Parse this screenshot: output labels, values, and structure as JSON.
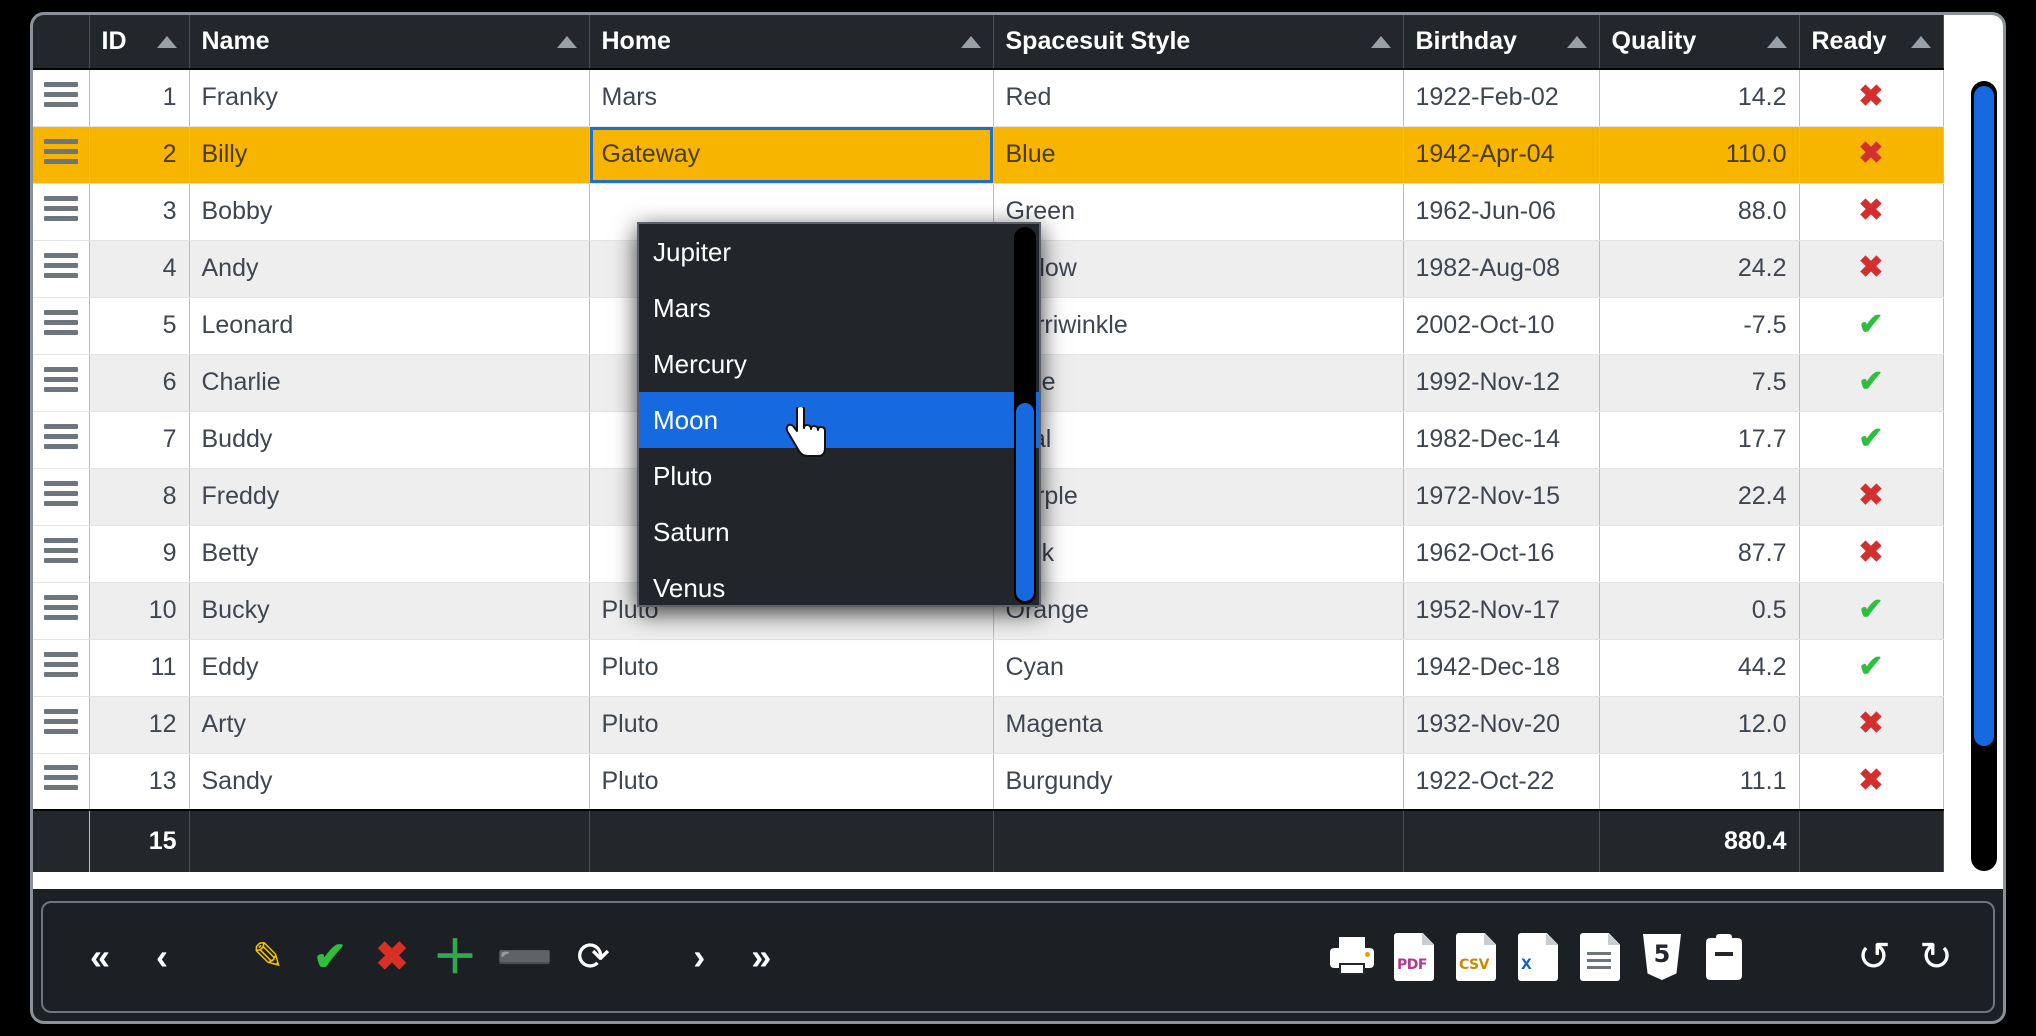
{
  "grid": {
    "columns": [
      {
        "key": "handle",
        "label": "",
        "sortable": false,
        "align": "center"
      },
      {
        "key": "id",
        "label": "ID",
        "sortable": true,
        "align": "right"
      },
      {
        "key": "name",
        "label": "Name",
        "sortable": true,
        "align": "left"
      },
      {
        "key": "home",
        "label": "Home",
        "sortable": true,
        "align": "left"
      },
      {
        "key": "spacesuit",
        "label": "Spacesuit Style",
        "sortable": true,
        "align": "left"
      },
      {
        "key": "birthday",
        "label": "Birthday",
        "sortable": true,
        "align": "left"
      },
      {
        "key": "quality",
        "label": "Quality",
        "sortable": true,
        "align": "right"
      },
      {
        "key": "ready",
        "label": "Ready",
        "sortable": true,
        "align": "center"
      }
    ],
    "rows": [
      {
        "id": "1",
        "name": "Franky",
        "home": "Mars",
        "spacesuit": "Red",
        "birthday": "1922-Feb-02",
        "quality": "14.2",
        "ready": "no"
      },
      {
        "id": "2",
        "name": "Billy",
        "home": "Gateway",
        "spacesuit": "Blue",
        "birthday": "1942-Apr-04",
        "quality": "110.0",
        "ready": "no"
      },
      {
        "id": "3",
        "name": "Bobby",
        "home": "",
        "spacesuit": "Green",
        "birthday": "1962-Jun-06",
        "quality": "88.0",
        "ready": "no"
      },
      {
        "id": "4",
        "name": "Andy",
        "home": "",
        "spacesuit": "Yellow",
        "birthday": "1982-Aug-08",
        "quality": "24.2",
        "ready": "no"
      },
      {
        "id": "5",
        "name": "Leonard",
        "home": "",
        "spacesuit": "Perriwinkle",
        "birthday": "2002-Oct-10",
        "quality": "-7.5",
        "ready": "yes"
      },
      {
        "id": "6",
        "name": "Charlie",
        "home": "",
        "spacesuit": "Blue",
        "birthday": "1992-Nov-12",
        "quality": "7.5",
        "ready": "yes"
      },
      {
        "id": "7",
        "name": "Buddy",
        "home": "",
        "spacesuit": "Teal",
        "birthday": "1982-Dec-14",
        "quality": "17.7",
        "ready": "yes"
      },
      {
        "id": "8",
        "name": "Freddy",
        "home": "",
        "spacesuit": "Purple",
        "birthday": "1972-Nov-15",
        "quality": "22.4",
        "ready": "no"
      },
      {
        "id": "9",
        "name": "Betty",
        "home": "",
        "spacesuit": "Pink",
        "birthday": "1962-Oct-16",
        "quality": "87.7",
        "ready": "no"
      },
      {
        "id": "10",
        "name": "Bucky",
        "home": "Pluto",
        "spacesuit": "Orange",
        "birthday": "1952-Nov-17",
        "quality": "0.5",
        "ready": "yes"
      },
      {
        "id": "11",
        "name": "Eddy",
        "home": "Pluto",
        "spacesuit": "Cyan",
        "birthday": "1942-Dec-18",
        "quality": "44.2",
        "ready": "yes"
      },
      {
        "id": "12",
        "name": "Arty",
        "home": "Pluto",
        "spacesuit": "Magenta",
        "birthday": "1932-Nov-20",
        "quality": "12.0",
        "ready": "no"
      },
      {
        "id": "13",
        "name": "Sandy",
        "home": "Pluto",
        "spacesuit": "Burgundy",
        "birthday": "1922-Oct-22",
        "quality": "11.1",
        "ready": "no"
      }
    ],
    "selected_row_index": 1,
    "editing_cell": {
      "row_index": 1,
      "column": "home",
      "value": "Gateway"
    },
    "footer": {
      "count": "15",
      "quality_total": "880.4"
    },
    "marks": {
      "yes": "✔",
      "no": "✖"
    },
    "colors": {
      "selected_row": "#f7b500",
      "header_bg": "#23272c",
      "highlight": "#1769e0",
      "check": "#2fbf3f",
      "cross": "#d32f2f"
    }
  },
  "dropdown": {
    "open": true,
    "for_column": "Home",
    "highlighted": "Moon",
    "options": [
      {
        "label": "Jupiter"
      },
      {
        "label": "Mars"
      },
      {
        "label": "Mercury"
      },
      {
        "label": "Moon"
      },
      {
        "label": "Pluto"
      },
      {
        "label": "Saturn"
      },
      {
        "label": "Venus"
      }
    ]
  },
  "toolbar": {
    "nav": [
      {
        "name": "first-page",
        "glyph": "«"
      },
      {
        "name": "previous-page",
        "glyph": "‹"
      }
    ],
    "edit": [
      {
        "name": "edit-row",
        "glyph": "✎",
        "title": "Edit"
      },
      {
        "name": "accept-edit",
        "glyph": "✔",
        "title": "Accept"
      },
      {
        "name": "cancel-edit",
        "glyph": "✖",
        "title": "Cancel"
      },
      {
        "name": "add-row",
        "glyph": "＋",
        "title": "Add"
      },
      {
        "name": "delete-row",
        "glyph": "➖",
        "title": "Delete"
      },
      {
        "name": "refresh",
        "glyph": "⟳",
        "title": "Refresh"
      }
    ],
    "nav_right": [
      {
        "name": "next-page",
        "glyph": "›"
      },
      {
        "name": "last-page",
        "glyph": "»"
      }
    ],
    "export": [
      {
        "name": "print",
        "label": ""
      },
      {
        "name": "export-pdf",
        "label": "PDF"
      },
      {
        "name": "export-csv",
        "label": "CSV"
      },
      {
        "name": "export-excel",
        "label": "X"
      },
      {
        "name": "export-doc",
        "label": ""
      },
      {
        "name": "export-html",
        "label": "5"
      },
      {
        "name": "copy-clipboard",
        "label": ""
      }
    ],
    "history": [
      {
        "name": "undo",
        "glyph": "↺"
      },
      {
        "name": "redo",
        "glyph": "↻"
      }
    ]
  }
}
